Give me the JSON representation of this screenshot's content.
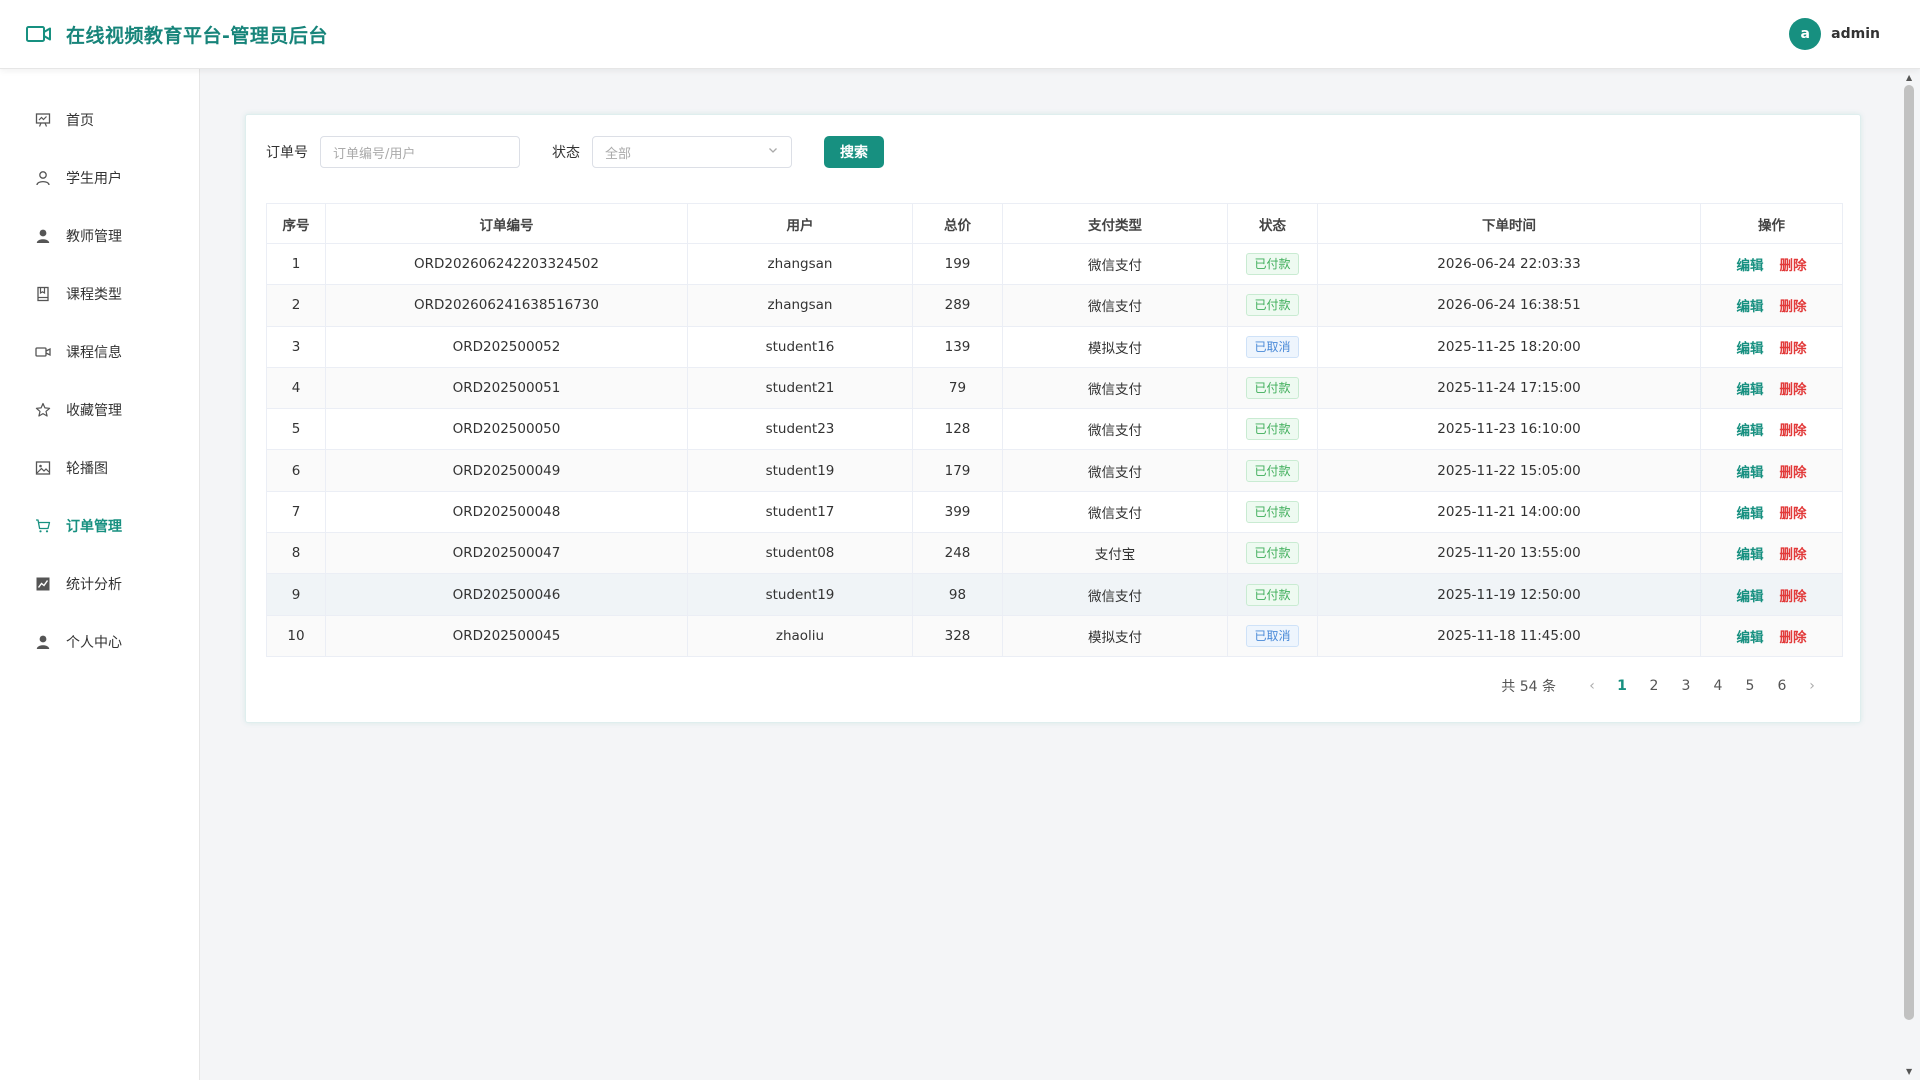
{
  "header": {
    "title": "在线视频教育平台-管理员后台",
    "avatar_letter": "a",
    "username": "admin",
    "brand_color": "#179080"
  },
  "sidebar": {
    "items": [
      {
        "label": "首页",
        "icon": "presentation-icon"
      },
      {
        "label": "学生用户",
        "icon": "user-outline-icon"
      },
      {
        "label": "教师管理",
        "icon": "user-solid-icon"
      },
      {
        "label": "课程类型",
        "icon": "notebook-icon"
      },
      {
        "label": "课程信息",
        "icon": "video-camera-icon"
      },
      {
        "label": "收藏管理",
        "icon": "star-icon"
      },
      {
        "label": "轮播图",
        "icon": "image-icon"
      },
      {
        "label": "订单管理",
        "icon": "shopping-cart-icon",
        "active": true
      },
      {
        "label": "统计分析",
        "icon": "chart-icon"
      },
      {
        "label": "个人中心",
        "icon": "user-solid-icon"
      }
    ]
  },
  "filters": {
    "order_label": "订单号",
    "order_placeholder": "订单编号/用户",
    "status_label": "状态",
    "status_value": "全部",
    "search_label": "搜索"
  },
  "table": {
    "headers": [
      "序号",
      "订单编号",
      "用户",
      "总价",
      "支付类型",
      "状态",
      "下单时间",
      "操作"
    ],
    "rows": [
      {
        "no": "1",
        "order": "ORD202606242203324502",
        "user": "zhangsan",
        "price": "199",
        "pay": "微信支付",
        "status": "已付款",
        "status_type": "paid",
        "time": "2026-06-24 22:03:33"
      },
      {
        "no": "2",
        "order": "ORD202606241638516730",
        "user": "zhangsan",
        "price": "289",
        "pay": "微信支付",
        "status": "已付款",
        "status_type": "paid",
        "time": "2026-06-24 16:38:51"
      },
      {
        "no": "3",
        "order": "ORD202500052",
        "user": "student16",
        "price": "139",
        "pay": "模拟支付",
        "status": "已取消",
        "status_type": "cancel",
        "time": "2025-11-25 18:20:00"
      },
      {
        "no": "4",
        "order": "ORD202500051",
        "user": "student21",
        "price": "79",
        "pay": "微信支付",
        "status": "已付款",
        "status_type": "paid",
        "time": "2025-11-24 17:15:00"
      },
      {
        "no": "5",
        "order": "ORD202500050",
        "user": "student23",
        "price": "128",
        "pay": "微信支付",
        "status": "已付款",
        "status_type": "paid",
        "time": "2025-11-23 16:10:00"
      },
      {
        "no": "6",
        "order": "ORD202500049",
        "user": "student19",
        "price": "179",
        "pay": "微信支付",
        "status": "已付款",
        "status_type": "paid",
        "time": "2025-11-22 15:05:00"
      },
      {
        "no": "7",
        "order": "ORD202500048",
        "user": "student17",
        "price": "399",
        "pay": "微信支付",
        "status": "已付款",
        "status_type": "paid",
        "time": "2025-11-21 14:00:00"
      },
      {
        "no": "8",
        "order": "ORD202500047",
        "user": "student08",
        "price": "248",
        "pay": "支付宝",
        "status": "已付款",
        "status_type": "paid",
        "time": "2025-11-20 13:55:00"
      },
      {
        "no": "9",
        "order": "ORD202500046",
        "user": "student19",
        "price": "98",
        "pay": "微信支付",
        "status": "已付款",
        "status_type": "paid",
        "time": "2025-11-19 12:50:00"
      },
      {
        "no": "10",
        "order": "ORD202500045",
        "user": "zhaoliu",
        "price": "328",
        "pay": "模拟支付",
        "status": "已取消",
        "status_type": "cancel",
        "time": "2025-11-18 11:45:00"
      }
    ],
    "edit_label": "编辑",
    "delete_label": "删除"
  },
  "pagination": {
    "total_text": "共 54 条",
    "pages": [
      "1",
      "2",
      "3",
      "4",
      "5",
      "6"
    ],
    "current": "1"
  }
}
